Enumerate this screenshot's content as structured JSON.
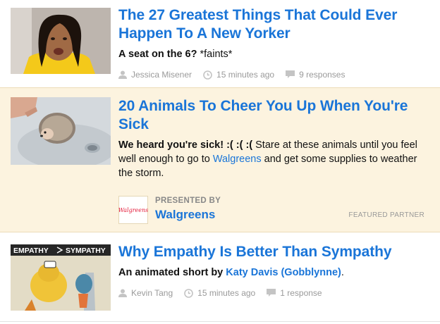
{
  "articles": [
    {
      "headline": "The 27 Greatest Things That Could Ever Happen To A New Yorker",
      "dek_bold": "A seat on the 6?",
      "dek_rest": "*faints*",
      "author": "Jessica Misener",
      "time": "15 minutes ago",
      "responses": "9 responses"
    },
    {
      "headline": "20 Animals To Cheer You Up When You're Sick",
      "dek_bold": "We heard you're sick! :( :( :(",
      "dek_pre": "Stare at these animals until you feel well enough to go to",
      "dek_link": "Walgreens",
      "dek_post": "and get some supplies to weather the storm.",
      "presented_label": "PRESENTED BY",
      "sponsor_name": "Walgreens",
      "sponsor_logo_text": "Walgreens",
      "featured_label": "FEATURED PARTNER"
    },
    {
      "headline": "Why Empathy Is Better Than Sympathy",
      "dek_bold": "An animated short by",
      "dek_link": "Katy Davis (Gobblynne)",
      "dek_end": ".",
      "thumb_caption_left": "EMPATHY",
      "thumb_caption_right": "SYMPATHY",
      "author": "Kevin Tang",
      "time": "15 minutes ago",
      "responses": "1 response"
    }
  ],
  "colors": {
    "link": "#1a75d8",
    "featured_bg": "#fcf3df",
    "meta": "#9a9a9a"
  },
  "icons": {
    "author": "person-icon",
    "time": "clock-icon",
    "responses": "comment-icon"
  }
}
